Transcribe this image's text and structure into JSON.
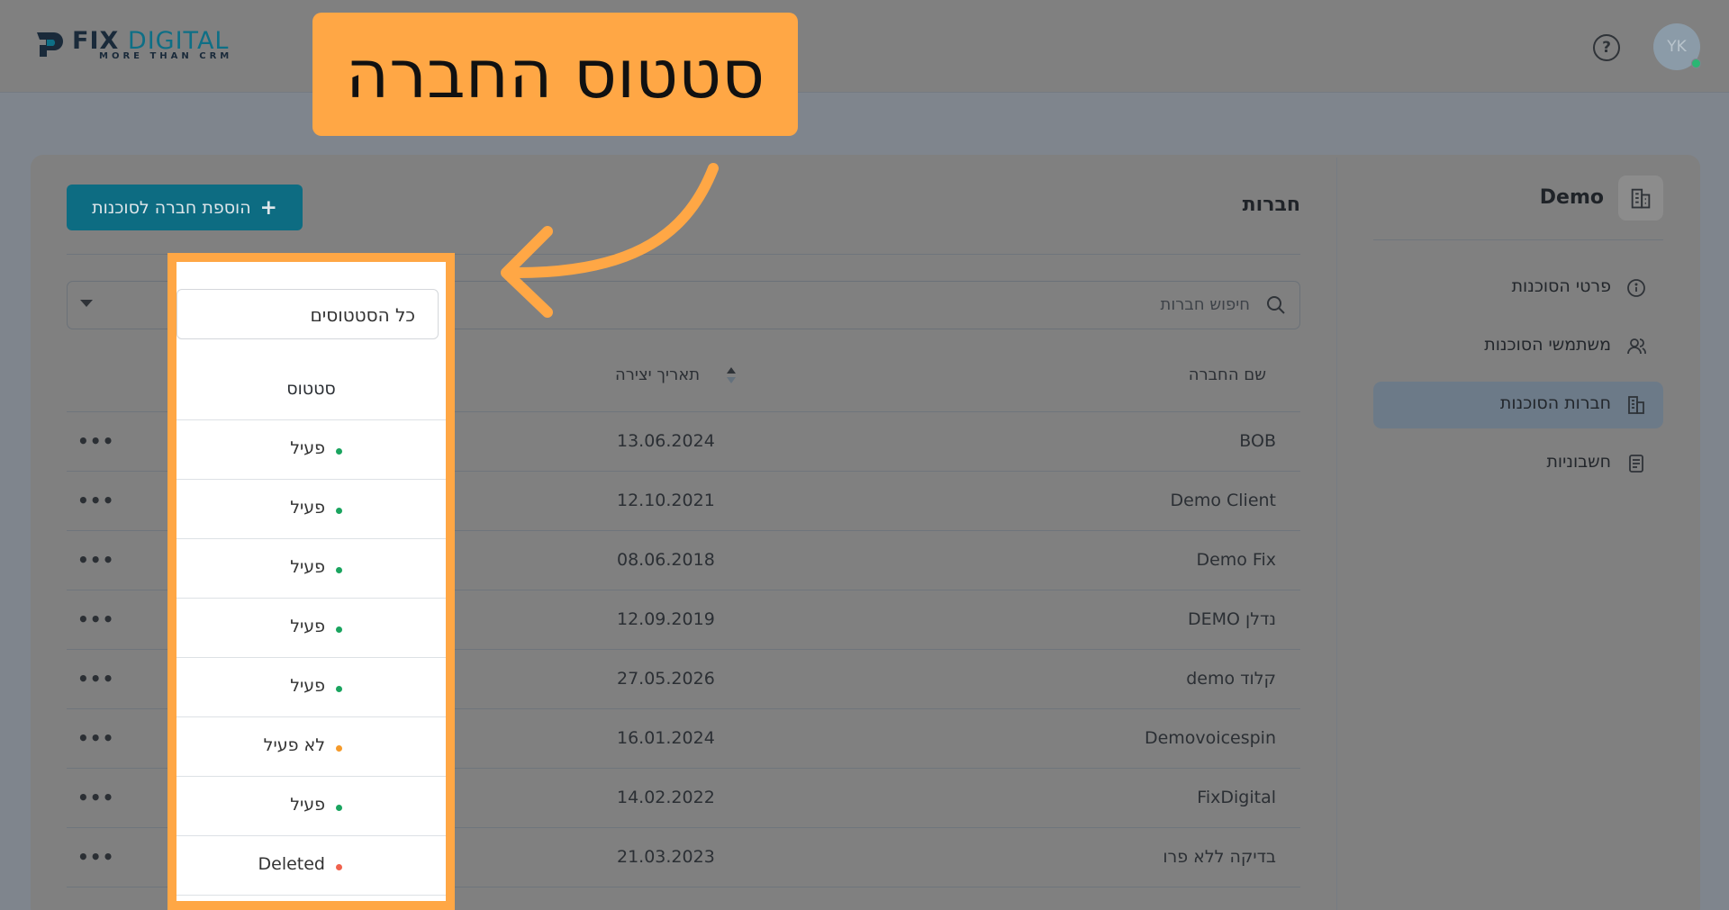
{
  "header": {
    "logo": {
      "brand_fix": "FIX",
      "brand_digital": "DIGITAL",
      "tagline": "MORE THAN CRM"
    },
    "help_icon": "question-circle-icon",
    "avatar_initials": "YK"
  },
  "callout": {
    "text": "סטטוס החברה"
  },
  "sidebar": {
    "title": "Demo",
    "items": [
      {
        "label": "פרטי הסוכנות",
        "icon": "info-icon",
        "active": false
      },
      {
        "label": "משתמשי הסוכנות",
        "icon": "users-icon",
        "active": false
      },
      {
        "label": "חברות הסוכנות",
        "icon": "building-icon",
        "active": true
      },
      {
        "label": "חשבוניות",
        "icon": "document-icon",
        "active": false
      }
    ]
  },
  "main": {
    "heading": "חברות",
    "add_button": "הוספת חברה לסוכנות",
    "search_placeholder": "חיפוש חברות",
    "status_filter": "כל הסטטוסים",
    "columns": {
      "name": "שם החברה",
      "date": "תאריך יצירה",
      "status": "סטטוס"
    },
    "rows": [
      {
        "name": "BOB",
        "date": "13.06.2024",
        "status": "פעיל",
        "status_color": "#1aa45f"
      },
      {
        "name": "Demo Client",
        "date": "12.10.2021",
        "status": "פעיל",
        "status_color": "#1aa45f"
      },
      {
        "name": "Demo Fix",
        "date": "08.06.2018",
        "status": "פעיל",
        "status_color": "#1aa45f"
      },
      {
        "name": "DEMO נדלן",
        "date": "12.09.2019",
        "status": "פעיל",
        "status_color": "#1aa45f"
      },
      {
        "name": "demo קלוד",
        "date": "27.05.2026",
        "status": "פעיל",
        "status_color": "#1aa45f"
      },
      {
        "name": "Demovoicespin",
        "date": "16.01.2024",
        "status": "לא פעיל",
        "status_color": "#f59a2a"
      },
      {
        "name": "FixDigital",
        "date": "14.02.2022",
        "status": "פעיל",
        "status_color": "#1aa45f"
      },
      {
        "name": "בדיקה ללא פרו",
        "date": "21.03.2023",
        "status": "Deleted",
        "status_color": "#f0624d"
      }
    ]
  },
  "colors": {
    "accent": "#0d6c82",
    "highlight": "#ffa745"
  }
}
